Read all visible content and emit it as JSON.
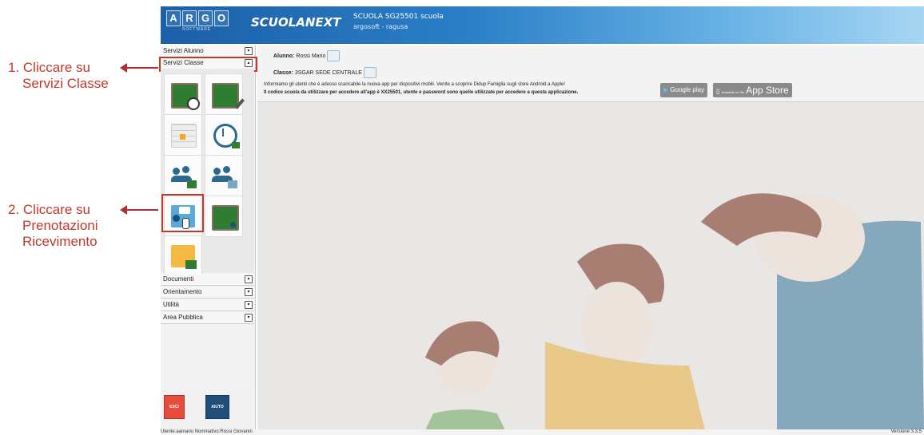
{
  "annotations": {
    "step1_line1": "1. Cliccare su",
    "step1_line2": "Servizi Classe",
    "step2_line1": "2. Cliccare su",
    "step2_line2": "Prenotazioni",
    "step2_line3": "Ricevimento"
  },
  "header": {
    "logo_letters": [
      "A",
      "R",
      "G",
      "O"
    ],
    "logo_sub": "SOFTWARE",
    "brand": "SCUOLANEXT",
    "school": "SCUOLA SG25501 scuola",
    "location": "argosoft - ragusa"
  },
  "sidebar": {
    "menus": [
      {
        "label": "Servizi Alunno"
      },
      {
        "label": "Servizi Classe"
      },
      {
        "label": "Documenti"
      },
      {
        "label": "Orientamento"
      },
      {
        "label": "Utilità"
      },
      {
        "label": "Area Pubblica"
      }
    ],
    "esci_label": "ESCI",
    "aiuto_label": "AIUTO"
  },
  "main": {
    "alunno_label": "Alunno:",
    "alunno_value": "Rossi Mario",
    "classe_label": "Classe:",
    "classe_value": "3SGAR SEDE CENTRALE",
    "info_line1": "Informiamo gli utenti che è adesso scaricabile la nuova app per dispositivi mobili. Venite a scoprire Didup Famiglia sugli store Android a Apple!",
    "info_line2": "Il codice scuola da utilizzare per accedere all'app è XX25501, utente e password sono quelle utilizzate per accedere a questa applicazione.",
    "google_play": "Google play",
    "app_store_small": "Available on the",
    "app_store": "App Store"
  },
  "footer": {
    "user_info": "Utente:aamario Nominativo:Rossi Giovanni",
    "version": "Versione 3.3.5"
  },
  "colors": {
    "accent_red": "#c0392b",
    "header_blue": "#1b5fa8"
  }
}
